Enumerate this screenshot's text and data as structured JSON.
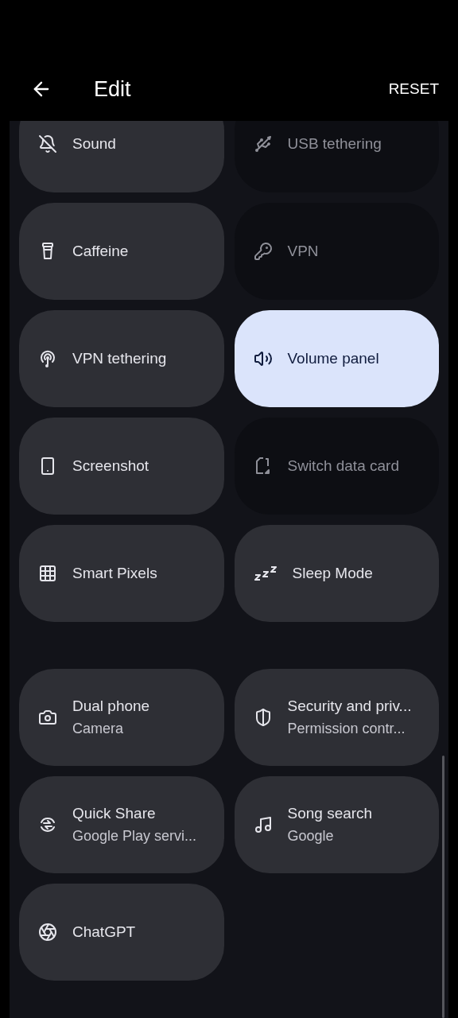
{
  "header": {
    "title": "Edit",
    "reset": "RESET"
  },
  "sections": [
    {
      "tiles": [
        {
          "label": "Sound",
          "on": false,
          "disabled": false
        },
        {
          "label": "USB tethering",
          "on": false,
          "disabled": true
        },
        {
          "label": "Caffeine",
          "on": false,
          "disabled": false
        },
        {
          "label": "VPN",
          "on": false,
          "disabled": true
        },
        {
          "label": "VPN tethering",
          "on": false,
          "disabled": false
        },
        {
          "label": "Volume panel",
          "on": true,
          "disabled": false
        },
        {
          "label": "Screenshot",
          "on": false,
          "disabled": false
        },
        {
          "label": "Switch data card",
          "on": false,
          "disabled": true
        },
        {
          "label": "Smart Pixels",
          "on": false,
          "disabled": false
        },
        {
          "label": "Sleep Mode",
          "on": false,
          "disabled": false
        }
      ]
    },
    {
      "tiles": [
        {
          "label": "Dual phone",
          "subtitle": "Camera",
          "on": false,
          "disabled": false
        },
        {
          "label": "Security and priv...",
          "subtitle": "Permission contr...",
          "on": false,
          "disabled": false
        },
        {
          "label": "Quick Share",
          "subtitle": "Google Play servi...",
          "on": false,
          "disabled": false
        },
        {
          "label": "Song search",
          "subtitle": "Google",
          "on": false,
          "disabled": false
        },
        {
          "label": "ChatGPT",
          "on": false,
          "disabled": false
        }
      ]
    }
  ]
}
